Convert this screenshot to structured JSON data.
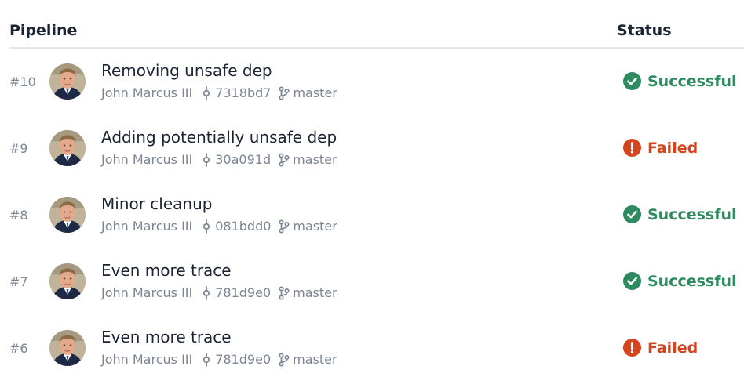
{
  "header": {
    "pipeline_label": "Pipeline",
    "status_label": "Status"
  },
  "colors": {
    "success": "#2e8a5f",
    "failed": "#d4451d",
    "muted": "#7c8593",
    "title": "#1c2433"
  },
  "icons": {
    "commit": "commit-icon",
    "branch": "branch-icon",
    "success": "check-circle-icon",
    "failed": "exclamation-circle-icon"
  },
  "rows": [
    {
      "number": "#10",
      "title": "Removing unsafe dep",
      "author": "John Marcus III",
      "commit": "7318bd7",
      "branch": "master",
      "status": "Successful",
      "state": "success"
    },
    {
      "number": "#9",
      "title": "Adding potentially unsafe dep",
      "author": "John Marcus III",
      "commit": "30a091d",
      "branch": "master",
      "status": "Failed",
      "state": "failed"
    },
    {
      "number": "#8",
      "title": "Minor cleanup",
      "author": "John Marcus III",
      "commit": "081bdd0",
      "branch": "master",
      "status": "Successful",
      "state": "success"
    },
    {
      "number": "#7",
      "title": "Even more trace",
      "author": "John Marcus III",
      "commit": "781d9e0",
      "branch": "master",
      "status": "Successful",
      "state": "success"
    },
    {
      "number": "#6",
      "title": "Even more trace",
      "author": "John Marcus III",
      "commit": "781d9e0",
      "branch": "master",
      "status": "Failed",
      "state": "failed"
    }
  ]
}
